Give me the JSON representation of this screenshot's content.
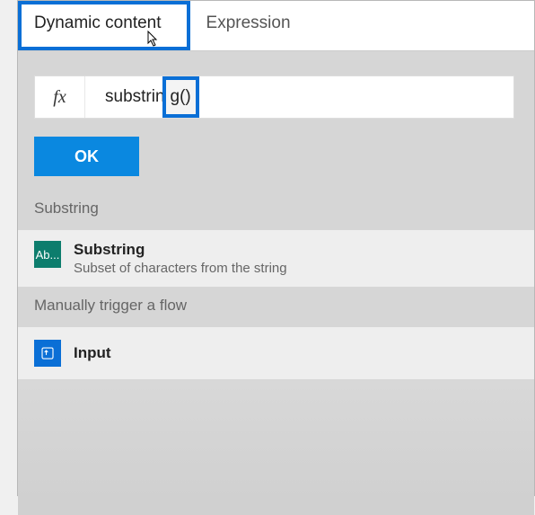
{
  "tabs": {
    "dynamic": "Dynamic content",
    "expression": "Expression"
  },
  "formula": {
    "fx": "fx",
    "prefix": "substrin",
    "suffix": "g()"
  },
  "buttons": {
    "ok": "OK"
  },
  "sections": {
    "substring": {
      "header": "Substring",
      "item_title": "Substring",
      "item_desc": "Subset of characters from the string",
      "icon_text": "Ab..."
    },
    "trigger": {
      "header": "Manually trigger a flow",
      "item_title": "Input"
    }
  }
}
